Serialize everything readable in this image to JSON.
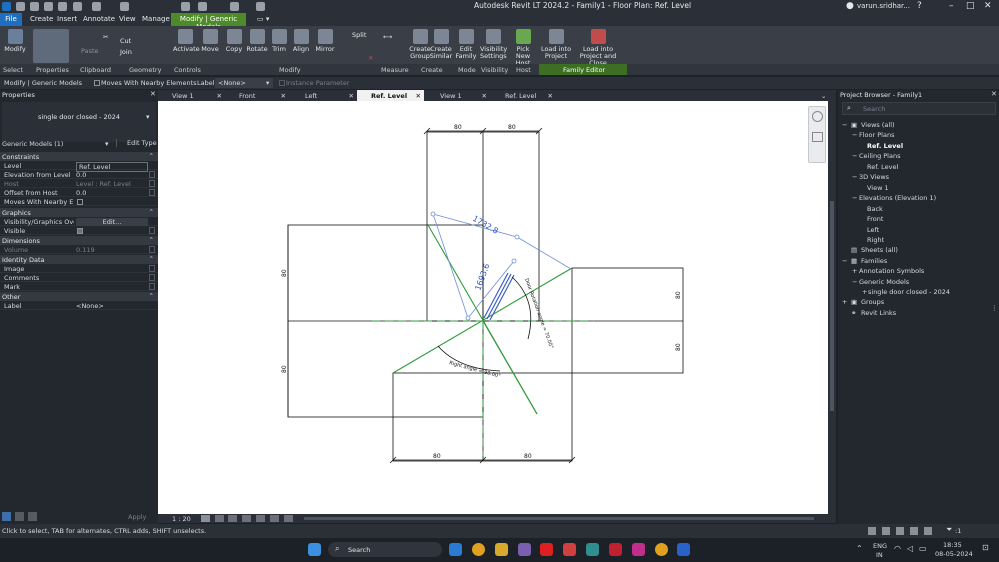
{
  "titlebar": {
    "title": "Autodesk Revit LT 2024.2 - Family1 - Floor Plan: Ref. Level",
    "user": "varun.sridhar..."
  },
  "menu": {
    "file": "File",
    "items": [
      "Create",
      "Insert",
      "Annotate",
      "View",
      "Manage"
    ],
    "context_tab": "Modify | Generic Models"
  },
  "ribbon": {
    "modify": "Modify",
    "select": "Select",
    "properties": "Properties",
    "paste": "Paste",
    "clipboard": "Clipboard",
    "cut": "Cut",
    "join": "Join",
    "geometry": "Geometry",
    "activate": "Activate",
    "controls": "Controls",
    "move": "Move",
    "copy": "Copy",
    "rotate": "Rotate",
    "trim": "Trim",
    "align": "Align",
    "mirror": "Mirror",
    "split": "Split",
    "modify_panel": "Modify",
    "measure": "Measure",
    "create_group_1": "Create",
    "create_group_2": "Group",
    "create_similar_1": "Create",
    "create_similar_2": "Similar",
    "create": "Create",
    "edit_family_1": "Edit",
    "edit_family_2": "Family",
    "mode": "Mode",
    "vis_1": "Visibility",
    "vis_2": "Settings",
    "visibility": "Visibility",
    "pick_1": "Pick",
    "pick_2": "New Host",
    "host": "Host",
    "load_1": "Load into",
    "load_2": "Project",
    "loadclose_1": "Load into",
    "loadclose_2": "Project and Close",
    "family_editor": "Family Editor"
  },
  "optbar": {
    "context": "Modify | Generic Models",
    "move_with": "Moves With Nearby Elements",
    "label": "Label:",
    "label_value": "<None>",
    "instance_param": "Instance Parameter"
  },
  "properties": {
    "header": "Properties",
    "type_name": "single door closed - 2024",
    "selector": "Generic Models (1)",
    "edit_type": "Edit Type",
    "sections": {
      "constraints": "Constraints",
      "graphics": "Graphics",
      "dimensions": "Dimensions",
      "identity": "Identity Data",
      "other": "Other"
    },
    "rows": {
      "level_k": "Level",
      "level_v": "Ref. Level",
      "elev_k": "Elevation from Level",
      "elev_v": "0.0",
      "host_k": "Host",
      "host_v": "Level : Ref. Level",
      "offset_k": "Offset from Host",
      "offset_v": "0.0",
      "moves_k": "Moves With Nearby Ele...",
      "vg_k": "Visibility/Graphics Over...",
      "vg_v": "Edit...",
      "visible_k": "Visible",
      "volume_k": "Volume",
      "volume_v": "0.119",
      "image_k": "Image",
      "comments_k": "Comments",
      "mark_k": "Mark",
      "label_k": "Label",
      "label_v": "<None>"
    },
    "apply": "Apply"
  },
  "tabs": [
    {
      "label": "View 1",
      "active": false
    },
    {
      "label": "Front",
      "active": false
    },
    {
      "label": "Left",
      "active": false
    },
    {
      "label": "Ref. Level",
      "active": true
    },
    {
      "label": "View 1",
      "active": false
    },
    {
      "label": "Ref. Level",
      "active": false
    }
  ],
  "drawing": {
    "dim_80": "80",
    "dim_1732": "1732.8",
    "dim_1693": "1693.6",
    "door_angle": "Door Rotation angle = 70.00°",
    "right_angle": "Right angle = 90.00°"
  },
  "viewbar": {
    "scale": "1 : 20"
  },
  "browser": {
    "header": "Project Browser - Family1",
    "search_placeholder": "Search",
    "items": {
      "views": "Views (all)",
      "floor_plans": "Floor Plans",
      "ref_level": "Ref. Level",
      "ceiling_plans": "Ceiling Plans",
      "ref_level2": "Ref. Level",
      "views3d": "3D Views",
      "view1": "View 1",
      "elevations": "Elevations (Elevation 1)",
      "back": "Back",
      "front": "Front",
      "left": "Left",
      "right": "Right",
      "sheets": "Sheets (all)",
      "families": "Families",
      "annotation": "Annotation Symbols",
      "generic": "Generic Models",
      "door": "single door closed - 2024",
      "groups": "Groups",
      "revit_links": "Revit Links"
    }
  },
  "status": {
    "hint": "Click to select, TAB for alternates, CTRL adds, SHIFT unselects.",
    "selection_count": ":1"
  },
  "taskbar": {
    "search": "Search",
    "lang1": "ENG",
    "lang2": "IN",
    "time": "18:35",
    "date": "08-05-2024"
  },
  "colors": {
    "green_contextual": "#4d8a2a",
    "file_blue": "#1e6fc0",
    "dimension_blue": "#3b6fd8",
    "green_line": "#2e9b3a"
  }
}
